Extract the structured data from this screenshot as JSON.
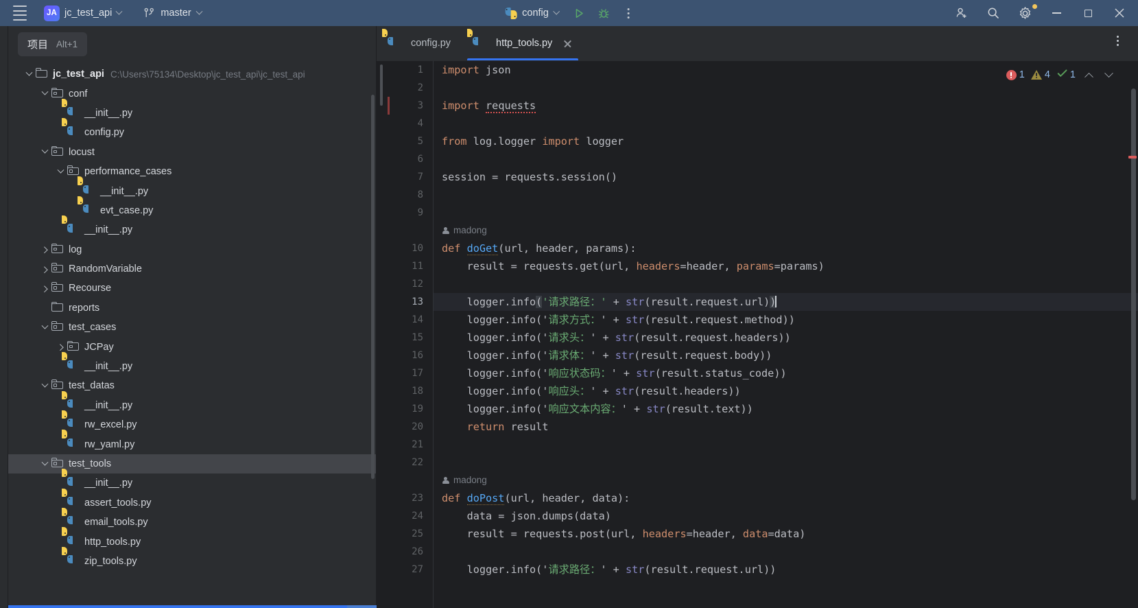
{
  "titlebar": {
    "menu_icon": "hamburger-icon",
    "project_badge": "JA",
    "project_name": "jc_test_api",
    "branch_icon": "git-branch-icon",
    "branch_name": "master",
    "run_config_icon": "python-icon",
    "run_config": "config",
    "run_icon": "run-play-icon",
    "debug_icon": "debug-bug-icon",
    "more_icon": "more-vertical-icon",
    "add_user_icon": "add-user-icon",
    "search_icon": "search-icon",
    "settings_icon": "gear-icon",
    "minimize_icon": "minimize-icon",
    "maximize_icon": "maximize-icon",
    "close_icon": "close-icon"
  },
  "project_panel": {
    "tab_label": "项目",
    "tab_shortcut": "Alt+1",
    "tree": [
      {
        "label": "jc_test_api",
        "path": "C:\\Users\\75134\\Desktop\\jc_test_api\\jc_test_api",
        "indent": 0,
        "arrow": "down",
        "icon": "folder-icon",
        "bold": true,
        "selected": false
      },
      {
        "label": "conf",
        "path": "",
        "indent": 1,
        "arrow": "down",
        "icon": "package-folder-icon",
        "bold": false,
        "selected": false
      },
      {
        "label": "__init__.py",
        "path": "",
        "indent": 2,
        "arrow": "none",
        "icon": "python-file-icon",
        "bold": false,
        "selected": false
      },
      {
        "label": "config.py",
        "path": "",
        "indent": 2,
        "arrow": "none",
        "icon": "python-file-icon",
        "bold": false,
        "selected": false
      },
      {
        "label": "locust",
        "path": "",
        "indent": 1,
        "arrow": "down",
        "icon": "package-folder-icon",
        "bold": false,
        "selected": false
      },
      {
        "label": "performance_cases",
        "path": "",
        "indent": 2,
        "arrow": "down",
        "icon": "package-folder-icon",
        "bold": false,
        "selected": false
      },
      {
        "label": "__init__.py",
        "path": "",
        "indent": 3,
        "arrow": "none",
        "icon": "python-file-icon",
        "bold": false,
        "selected": false
      },
      {
        "label": "evt_case.py",
        "path": "",
        "indent": 3,
        "arrow": "none",
        "icon": "python-file-icon",
        "bold": false,
        "selected": false
      },
      {
        "label": "__init__.py",
        "path": "",
        "indent": 2,
        "arrow": "none",
        "icon": "python-file-icon",
        "bold": false,
        "selected": false
      },
      {
        "label": "log",
        "path": "",
        "indent": 1,
        "arrow": "right",
        "icon": "package-folder-icon",
        "bold": false,
        "selected": false
      },
      {
        "label": "RandomVariable",
        "path": "",
        "indent": 1,
        "arrow": "right",
        "icon": "package-folder-icon",
        "bold": false,
        "selected": false
      },
      {
        "label": "Recourse",
        "path": "",
        "indent": 1,
        "arrow": "right",
        "icon": "package-folder-icon",
        "bold": false,
        "selected": false
      },
      {
        "label": "reports",
        "path": "",
        "indent": 1,
        "arrow": "none",
        "icon": "folder-icon",
        "bold": false,
        "selected": false
      },
      {
        "label": "test_cases",
        "path": "",
        "indent": 1,
        "arrow": "down",
        "icon": "package-folder-icon",
        "bold": false,
        "selected": false
      },
      {
        "label": "JCPay",
        "path": "",
        "indent": 2,
        "arrow": "right",
        "icon": "package-folder-icon",
        "bold": false,
        "selected": false
      },
      {
        "label": "__init__.py",
        "path": "",
        "indent": 2,
        "arrow": "none",
        "icon": "python-file-icon",
        "bold": false,
        "selected": false
      },
      {
        "label": "test_datas",
        "path": "",
        "indent": 1,
        "arrow": "down",
        "icon": "package-folder-icon",
        "bold": false,
        "selected": false
      },
      {
        "label": "__init__.py",
        "path": "",
        "indent": 2,
        "arrow": "none",
        "icon": "python-file-icon",
        "bold": false,
        "selected": false
      },
      {
        "label": "rw_excel.py",
        "path": "",
        "indent": 2,
        "arrow": "none",
        "icon": "python-file-icon",
        "bold": false,
        "selected": false
      },
      {
        "label": "rw_yaml.py",
        "path": "",
        "indent": 2,
        "arrow": "none",
        "icon": "python-file-icon",
        "bold": false,
        "selected": false
      },
      {
        "label": "test_tools",
        "path": "",
        "indent": 1,
        "arrow": "down",
        "icon": "package-folder-icon",
        "bold": false,
        "selected": true
      },
      {
        "label": "__init__.py",
        "path": "",
        "indent": 2,
        "arrow": "none",
        "icon": "python-file-icon",
        "bold": false,
        "selected": false
      },
      {
        "label": "assert_tools.py",
        "path": "",
        "indent": 2,
        "arrow": "none",
        "icon": "python-file-icon",
        "bold": false,
        "selected": false
      },
      {
        "label": "email_tools.py",
        "path": "",
        "indent": 2,
        "arrow": "none",
        "icon": "python-file-icon",
        "bold": false,
        "selected": false
      },
      {
        "label": "http_tools.py",
        "path": "",
        "indent": 2,
        "arrow": "none",
        "icon": "python-file-icon",
        "bold": false,
        "selected": false
      },
      {
        "label": "zip_tools.py",
        "path": "",
        "indent": 2,
        "arrow": "none",
        "icon": "python-file-icon",
        "bold": false,
        "selected": false
      }
    ]
  },
  "editor": {
    "tabs": [
      {
        "label": "config.py",
        "icon": "python-file-icon",
        "active": false,
        "closable": false
      },
      {
        "label": "http_tools.py",
        "icon": "python-file-icon",
        "active": true,
        "closable": true
      }
    ],
    "tabs_more_icon": "more-vertical-icon",
    "inspection": {
      "error_icon": "error-icon",
      "error_count": "1",
      "warning_icon": "warning-icon",
      "warning_count": "4",
      "ok_icon": "checkmark-icon",
      "ok_count": "1",
      "prev_icon": "chevron-up-icon",
      "next_icon": "chevron-down-icon"
    },
    "caret_line": 13,
    "vcs_author": "madong",
    "lines": [
      {
        "n": 1,
        "tokens": [
          {
            "t": "import",
            "c": "kw"
          },
          {
            "t": " json",
            "c": "op"
          }
        ]
      },
      {
        "n": 2,
        "tokens": []
      },
      {
        "n": 3,
        "tokens": [
          {
            "t": "import",
            "c": "kw"
          },
          {
            "t": " ",
            "c": "op"
          },
          {
            "t": "requests",
            "c": "op sq"
          }
        ]
      },
      {
        "n": 4,
        "tokens": []
      },
      {
        "n": 5,
        "tokens": [
          {
            "t": "from",
            "c": "kw"
          },
          {
            "t": " log.logger ",
            "c": "op"
          },
          {
            "t": "import",
            "c": "kw"
          },
          {
            "t": " logger",
            "c": "op"
          }
        ]
      },
      {
        "n": 6,
        "tokens": []
      },
      {
        "n": 7,
        "tokens": [
          {
            "t": "session = requests.session()",
            "c": "op"
          }
        ]
      },
      {
        "n": 8,
        "tokens": []
      },
      {
        "n": 9,
        "tokens": []
      },
      {
        "n": 10,
        "vcs": "madong",
        "tokens": [
          {
            "t": "def ",
            "c": "kw"
          },
          {
            "t": "doGet",
            "c": "fn"
          },
          {
            "t": "(url, header, params):",
            "c": "op"
          }
        ]
      },
      {
        "n": 11,
        "tokens": [
          {
            "t": "    result = requests.get(url, ",
            "c": "op"
          },
          {
            "t": "headers",
            "c": "kwarg2"
          },
          {
            "t": "=header, ",
            "c": "op"
          },
          {
            "t": "params",
            "c": "kwarg2"
          },
          {
            "t": "=params)",
            "c": "op"
          }
        ]
      },
      {
        "n": 12,
        "tokens": []
      },
      {
        "n": 13,
        "caret": true,
        "tokens": [
          {
            "t": "    logger.info",
            "c": "op"
          },
          {
            "t": "(",
            "c": "op pmatch"
          },
          {
            "t": "'请求路径：'",
            "c": "str"
          },
          {
            "t": " + ",
            "c": "op"
          },
          {
            "t": "str",
            "c": "bi"
          },
          {
            "t": "(result.request.url)",
            "c": "op"
          },
          {
            "t": ")",
            "c": "op pmatch"
          }
        ]
      },
      {
        "n": 14,
        "tokens": [
          {
            "t": "    logger.info('",
            "c": "op"
          },
          {
            "t": "请求方式：",
            "c": "str"
          },
          {
            "t": "' + ",
            "c": "op"
          },
          {
            "t": "str",
            "c": "bi"
          },
          {
            "t": "(result.request.method))",
            "c": "op"
          }
        ]
      },
      {
        "n": 15,
        "tokens": [
          {
            "t": "    logger.info('",
            "c": "op"
          },
          {
            "t": "请求头：",
            "c": "str"
          },
          {
            "t": "' + ",
            "c": "op"
          },
          {
            "t": "str",
            "c": "bi"
          },
          {
            "t": "(result.request.headers))",
            "c": "op"
          }
        ]
      },
      {
        "n": 16,
        "tokens": [
          {
            "t": "    logger.info('",
            "c": "op"
          },
          {
            "t": "请求体：",
            "c": "str"
          },
          {
            "t": "' + ",
            "c": "op"
          },
          {
            "t": "str",
            "c": "bi"
          },
          {
            "t": "(result.request.body))",
            "c": "op"
          }
        ]
      },
      {
        "n": 17,
        "tokens": [
          {
            "t": "    logger.info('",
            "c": "op"
          },
          {
            "t": "响应状态码：",
            "c": "str"
          },
          {
            "t": "' + ",
            "c": "op"
          },
          {
            "t": "str",
            "c": "bi"
          },
          {
            "t": "(result.status_code))",
            "c": "op"
          }
        ]
      },
      {
        "n": 18,
        "tokens": [
          {
            "t": "    logger.info('",
            "c": "op"
          },
          {
            "t": "响应头：",
            "c": "str"
          },
          {
            "t": "' + ",
            "c": "op"
          },
          {
            "t": "str",
            "c": "bi"
          },
          {
            "t": "(result.headers))",
            "c": "op"
          }
        ]
      },
      {
        "n": 19,
        "tokens": [
          {
            "t": "    logger.info('",
            "c": "op"
          },
          {
            "t": "响应文本内容：",
            "c": "str"
          },
          {
            "t": "' + ",
            "c": "op"
          },
          {
            "t": "str",
            "c": "bi"
          },
          {
            "t": "(result.text))",
            "c": "op"
          }
        ]
      },
      {
        "n": 20,
        "tokens": [
          {
            "t": "    ",
            "c": "op"
          },
          {
            "t": "return",
            "c": "kw"
          },
          {
            "t": " result",
            "c": "op"
          }
        ]
      },
      {
        "n": 21,
        "tokens": []
      },
      {
        "n": 22,
        "tokens": []
      },
      {
        "n": 23,
        "vcs": "madong",
        "tokens": [
          {
            "t": "def ",
            "c": "kw"
          },
          {
            "t": "doPost",
            "c": "fn"
          },
          {
            "t": "(url, header, data):",
            "c": "op"
          }
        ]
      },
      {
        "n": 24,
        "tokens": [
          {
            "t": "    data = json.dumps(data)",
            "c": "op"
          }
        ]
      },
      {
        "n": 25,
        "tokens": [
          {
            "t": "    result = requests.post(url, ",
            "c": "op"
          },
          {
            "t": "headers",
            "c": "kwarg2"
          },
          {
            "t": "=header, ",
            "c": "op"
          },
          {
            "t": "data",
            "c": "kwarg2"
          },
          {
            "t": "=data)",
            "c": "op"
          }
        ]
      },
      {
        "n": 26,
        "tokens": []
      },
      {
        "n": 27,
        "tokens": [
          {
            "t": "    logger.info('",
            "c": "op"
          },
          {
            "t": "请求路径：",
            "c": "str"
          },
          {
            "t": "' + ",
            "c": "op"
          },
          {
            "t": "str",
            "c": "bi"
          },
          {
            "t": "(result.request.url))",
            "c": "op"
          }
        ]
      }
    ]
  },
  "colors": {
    "titlebar_bg": "#3c5371",
    "panel_bg": "#2b2d30",
    "editor_bg": "#1e1f22",
    "accent_blue": "#3574f0",
    "selection": "#43454a",
    "error_red": "#db5c5c",
    "warning_yellow": "#9b8b3f",
    "ok_green": "#5a9e5a",
    "string_green": "#6aab73",
    "keyword_orange": "#cf8e6d",
    "builtin_purple": "#8888c6",
    "function_blue": "#56a8f5"
  }
}
